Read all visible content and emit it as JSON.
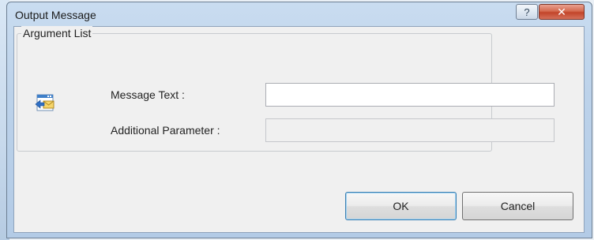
{
  "window": {
    "title": "Output Message",
    "help_label": "?",
    "close_label": "✕"
  },
  "group": {
    "legend": "Argument List"
  },
  "fields": {
    "message_text_label": "Message Text :",
    "message_text_value": "",
    "additional_parameter_label": "Additional Parameter :",
    "additional_parameter_value": ""
  },
  "buttons": {
    "ok_label": "OK",
    "cancel_label": "Cancel"
  },
  "icons": {
    "argument_icon": "output-message-icon"
  }
}
